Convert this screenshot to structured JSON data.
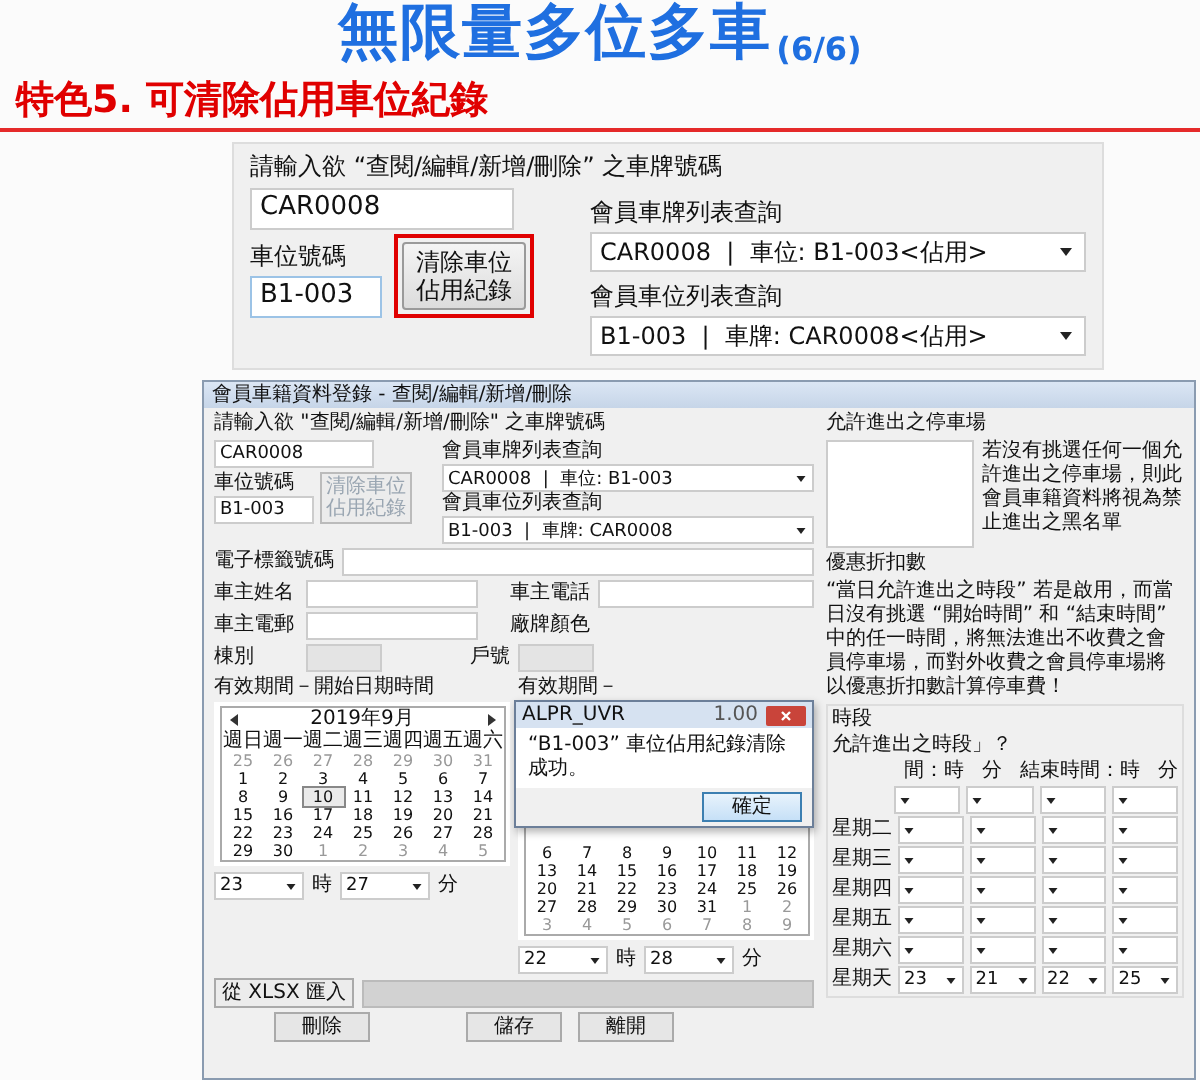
{
  "slide": {
    "title": "無限量多位多車",
    "counter": "(6/6)",
    "heading": "特色5. 可清除佔用車位紀錄"
  },
  "top_panel": {
    "prompt": "請輸入欲  “查閱/編輯/新增/刪除”  之車牌號碼",
    "plate_value": "CAR0008",
    "space_label": "車位號碼",
    "space_value": "B1-003",
    "clear_button": "清除車位佔用紀錄",
    "highlighted": true,
    "plate_list_label": "會員車牌列表查詢",
    "plate_list_value": "CAR0008  |  車位: B1-003<佔用>",
    "space_list_label": "會員車位列表查詢",
    "space_list_value": "B1-003  |  車牌: CAR0008<佔用>"
  },
  "window": {
    "title": "會員車籍資料登錄 - 查閱/編輯/新增/刪除",
    "prompt": "請輸入欲  \"查閱/編輯/新增/刪除\"  之車牌號碼",
    "plate_value": "CAR0008",
    "space_label": "車位號碼",
    "space_value": "B1-003",
    "clear_button": "清除車位佔用紀錄",
    "clear_disabled": true,
    "plate_list_label": "會員車牌列表查詢",
    "plate_list_value": "CAR0008  |  車位: B1-003",
    "space_list_label": "會員車位列表查詢",
    "space_list_value": "B1-003  |  車牌: CAR0008",
    "tag_label": "電子標籤號碼",
    "name_label": "車主姓名",
    "phone_label": "車主電話",
    "email_label": "車主電郵",
    "color_label": "廠牌顏色",
    "building_label": "棟別",
    "unit_label": "戶號",
    "date_groups": [
      {
        "label": "有效期間－開始日期時間",
        "calendar": {
          "title": "2019年9月",
          "weekdays": [
            "週日",
            "週一",
            "週二",
            "週三",
            "週四",
            "週五",
            "週六"
          ],
          "weeks": [
            [
              {
                "d": "25",
                "other": true,
                "selected": false
              },
              {
                "d": "26",
                "other": true,
                "selected": false
              },
              {
                "d": "27",
                "other": true,
                "selected": false
              },
              {
                "d": "28",
                "other": true,
                "selected": false
              },
              {
                "d": "29",
                "other": true,
                "selected": false
              },
              {
                "d": "30",
                "other": true,
                "selected": false
              },
              {
                "d": "31",
                "other": true,
                "selected": false
              }
            ],
            [
              {
                "d": "1",
                "other": false,
                "selected": false
              },
              {
                "d": "2",
                "other": false,
                "selected": false
              },
              {
                "d": "3",
                "other": false,
                "selected": false
              },
              {
                "d": "4",
                "other": false,
                "selected": false
              },
              {
                "d": "5",
                "other": false,
                "selected": false
              },
              {
                "d": "6",
                "other": false,
                "selected": false
              },
              {
                "d": "7",
                "other": false,
                "selected": false
              }
            ],
            [
              {
                "d": "8",
                "other": false,
                "selected": false
              },
              {
                "d": "9",
                "other": false,
                "selected": false
              },
              {
                "d": "10",
                "other": false,
                "selected": true
              },
              {
                "d": "11",
                "other": false,
                "selected": false
              },
              {
                "d": "12",
                "other": false,
                "selected": false
              },
              {
                "d": "13",
                "other": false,
                "selected": false
              },
              {
                "d": "14",
                "other": false,
                "selected": false
              }
            ],
            [
              {
                "d": "15",
                "other": false,
                "selected": false
              },
              {
                "d": "16",
                "other": false,
                "selected": false
              },
              {
                "d": "17",
                "other": false,
                "selected": false
              },
              {
                "d": "18",
                "other": false,
                "selected": false
              },
              {
                "d": "19",
                "other": false,
                "selected": false
              },
              {
                "d": "20",
                "other": false,
                "selected": false
              },
              {
                "d": "21",
                "other": false,
                "selected": false
              }
            ],
            [
              {
                "d": "22",
                "other": false,
                "selected": false
              },
              {
                "d": "23",
                "other": false,
                "selected": false
              },
              {
                "d": "24",
                "other": false,
                "selected": false
              },
              {
                "d": "25",
                "other": false,
                "selected": false
              },
              {
                "d": "26",
                "other": false,
                "selected": false
              },
              {
                "d": "27",
                "other": false,
                "selected": false
              },
              {
                "d": "28",
                "other": false,
                "selected": false
              }
            ],
            [
              {
                "d": "29",
                "other": false,
                "selected": false
              },
              {
                "d": "30",
                "other": false,
                "selected": false
              },
              {
                "d": "1",
                "other": true,
                "selected": false
              },
              {
                "d": "2",
                "other": true,
                "selected": false
              },
              {
                "d": "3",
                "other": true,
                "selected": false
              },
              {
                "d": "4",
                "other": true,
                "selected": false
              },
              {
                "d": "5",
                "other": true,
                "selected": false
              }
            ]
          ]
        },
        "hour": "23",
        "hour_unit": "時",
        "minute": "27",
        "minute_unit": "分"
      },
      {
        "label": "有效期間－",
        "calendar": {
          "weeks": [
            [
              {
                "d": "6",
                "other": false,
                "selected": false
              },
              {
                "d": "7",
                "other": false,
                "selected": false
              },
              {
                "d": "8",
                "other": false,
                "selected": false
              },
              {
                "d": "9",
                "other": false,
                "selected": false
              },
              {
                "d": "10",
                "other": false,
                "selected": false
              },
              {
                "d": "11",
                "other": false,
                "selected": false
              },
              {
                "d": "12",
                "other": false,
                "selected": false
              }
            ],
            [
              {
                "d": "13",
                "other": false,
                "selected": false
              },
              {
                "d": "14",
                "other": false,
                "selected": false
              },
              {
                "d": "15",
                "other": false,
                "selected": false
              },
              {
                "d": "16",
                "other": false,
                "selected": false
              },
              {
                "d": "17",
                "other": false,
                "selected": false
              },
              {
                "d": "18",
                "other": false,
                "selected": false
              },
              {
                "d": "19",
                "other": false,
                "selected": false
              }
            ],
            [
              {
                "d": "20",
                "other": false,
                "selected": false
              },
              {
                "d": "21",
                "other": false,
                "selected": false
              },
              {
                "d": "22",
                "other": false,
                "selected": false
              },
              {
                "d": "23",
                "other": false,
                "selected": false
              },
              {
                "d": "24",
                "other": false,
                "selected": false
              },
              {
                "d": "25",
                "other": false,
                "selected": false
              },
              {
                "d": "26",
                "other": false,
                "selected": false
              }
            ],
            [
              {
                "d": "27",
                "other": false,
                "selected": false
              },
              {
                "d": "28",
                "other": false,
                "selected": false
              },
              {
                "d": "29",
                "other": false,
                "selected": false
              },
              {
                "d": "30",
                "other": false,
                "selected": false
              },
              {
                "d": "31",
                "other": false,
                "selected": false
              },
              {
                "d": "1",
                "other": true,
                "selected": false
              },
              {
                "d": "2",
                "other": true,
                "selected": false
              }
            ],
            [
              {
                "d": "3",
                "other": true,
                "selected": false
              },
              {
                "d": "4",
                "other": true,
                "selected": false
              },
              {
                "d": "5",
                "other": true,
                "selected": false
              },
              {
                "d": "6",
                "other": true,
                "selected": false
              },
              {
                "d": "7",
                "other": true,
                "selected": false
              },
              {
                "d": "8",
                "other": true,
                "selected": false
              },
              {
                "d": "9",
                "other": true,
                "selected": false
              }
            ]
          ]
        },
        "hour": "22",
        "hour_unit": "時",
        "minute": "28",
        "minute_unit": "分"
      }
    ],
    "import_button": "從 XLSX 匯入",
    "import_progress": {
      "level": 0
    },
    "buttons": [
      "刪除",
      "儲存",
      "離開"
    ],
    "parking_label": "允許進出之停車場",
    "parking_note": "若沒有挑選任何一個允許進出之停車場，則此會員車籍資料將視為禁止進出之黑名單",
    "discount_label": "優惠折扣數",
    "discount_note": "“當日允許進出之時段” 若是啟用，而當日沒有挑選 “開始時間” 和 “結束時間” 中的任一時間，將無法進出不收費之會員停車場，而對外收費之會員停車場將以優惠折扣數計算停車費！",
    "schedule": {
      "title": "時段",
      "question": "允許進出之時段」？",
      "headers": [
        "間：時",
        "分",
        "結束時間：時",
        "分"
      ],
      "rows": [
        {
          "kind": "covered"
        },
        {
          "kind": "weekday",
          "day": "星期二"
        },
        {
          "kind": "weekday",
          "day": "星期三"
        },
        {
          "kind": "weekday",
          "day": "星期四"
        },
        {
          "kind": "weekday",
          "day": "星期五"
        },
        {
          "kind": "weekday",
          "day": "星期六"
        },
        {
          "kind": "weekday",
          "day": "星期天",
          "values": [
            "23",
            "21",
            "22",
            "25"
          ]
        }
      ]
    }
  },
  "dialog": {
    "title": "ALPR_UVR",
    "version": "1.00",
    "message": "“B1-003” 車位佔用紀錄清除成功。",
    "ok_button": "確定"
  }
}
